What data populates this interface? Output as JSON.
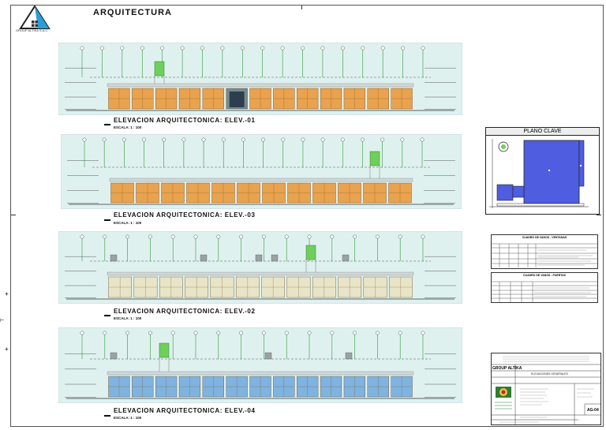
{
  "header": {
    "company_logo_text": "GROUP ALTIKA S.A.C.",
    "title": "ARQUITECTURA"
  },
  "elevations": [
    {
      "title": "ELEVACION ARQUITECTONICA: ELEV.-01",
      "scale": "ESCALA: 1 : 100"
    },
    {
      "title": "ELEVACION ARQUITECTONICA: ELEV.-03",
      "scale": "ESCALA: 1 : 100"
    },
    {
      "title": "ELEVACION ARQUITECTONICA: ELEV.-02",
      "scale": "ESCALA: 1 : 100"
    },
    {
      "title": "ELEVACION ARQUITECTONICA: ELEV.-04",
      "scale": "ESCALA: 1 : 100"
    }
  ],
  "key_plan": {
    "title": "PLANO CLAVE"
  },
  "tables": {
    "windows_title": "CUADRO DE VANOS - VENTANAS",
    "doors_title": "CUADRO DE VANOS - PUERTAS"
  },
  "title_block": {
    "company": "GROUP ALTIKA",
    "project_title": "ELEVACIONES GENERALES",
    "sheet_number": "AG-04"
  },
  "colors": {
    "sky": "#dff1ef",
    "panel_orange": "#e9a24e",
    "panel_blue": "#7fb3e0",
    "water_tank_green": "#6fcf5b",
    "key_plan_blue": "#4f5de0"
  }
}
